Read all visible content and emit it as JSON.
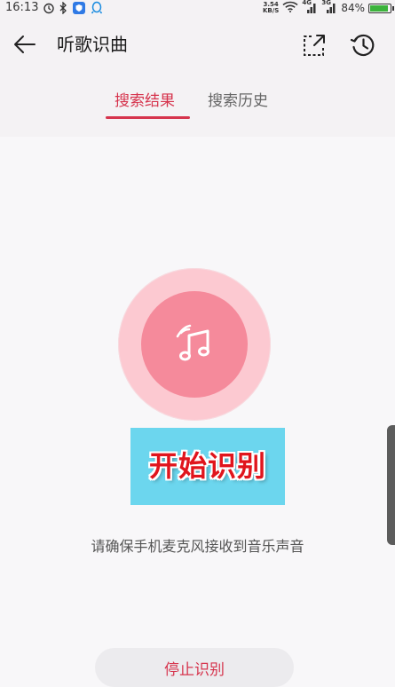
{
  "status_bar": {
    "time": "16:13",
    "net_speed_value": "3.54",
    "net_speed_unit": "KB/S",
    "battery_percent": "84%",
    "battery_level": 0.84,
    "signal_label_1": "4G",
    "signal_label_2": "3G"
  },
  "header": {
    "title": "听歌识曲",
    "back_icon": "arrow-left-icon",
    "share_icon": "open-external-icon",
    "history_icon": "history-clock-icon"
  },
  "tabs": [
    {
      "label": "搜索结果",
      "active": true
    },
    {
      "label": "搜索历史",
      "active": false
    }
  ],
  "main": {
    "recognize_icon": "music-note-wave-icon",
    "start_label": "开始识别",
    "hint": "请确保手机麦克风接收到音乐声音",
    "stop_label": "停止识别"
  },
  "colors": {
    "accent": "#d6344d",
    "circle_outer": "#fcc9d1",
    "circle_inner": "#f58a9b",
    "start_box": "#6cd6ee",
    "start_text": "#e0151d"
  }
}
